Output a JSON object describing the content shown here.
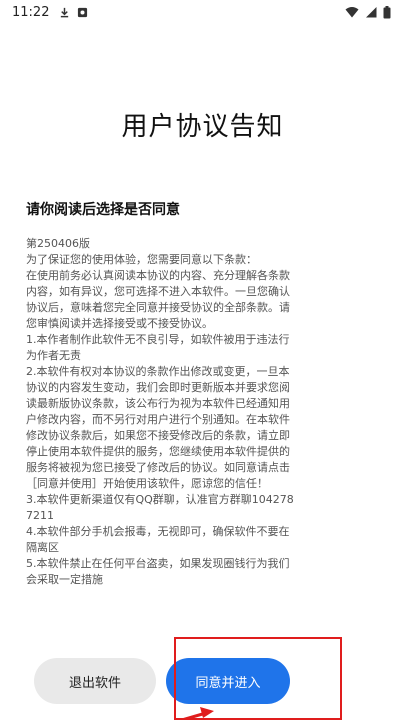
{
  "status_bar": {
    "time": "11:22",
    "notification_icons": [
      "download-icon",
      "app-notification-icon"
    ],
    "system_icons": [
      "wifi-icon",
      "cellular-signal-icon",
      "battery-icon"
    ]
  },
  "title": "用户协议告知",
  "subtitle": "请你阅读后选择是否同意",
  "agreement": {
    "text": "第250406版\n为了保证您的使用体验，您需要同意以下条款：\n在使用前务必认真阅读本协议的内容、充分理解各条款内容，如有异议，您可选择不进入本软件。一旦您确认协议后，意味着您完全同意并接受协议的全部条款。请您审慎阅读并选择接受或不接受协议。\n1.本作者制作此软件无不良引导，如软件被用于违法行为作者无责\n2.本软件有权对本协议的条款作出修改或变更，一旦本协议的内容发生变动，我们会即时更新版本并要求您阅读最新版协议条款，该公布行为视为本软件已经通知用户修改内容，而不另行对用户进行个别通知。在本软件修改协议条款后，如果您不接受修改后的条款，请立即停止使用本软件提供的服务，您继续使用本软件提供的服务将被视为您已接受了修改后的协议。如同意请点击［同意并使用］开始使用该软件，愿谅您的信任！\n3.本软件更新渠道仅有QQ群聊，认准官方群聊1042787211\n4.本软件部分手机会报毒，无视即可，确保软件不要在隔离区\n5.本软件禁止在任何平台盗卖，如果发现圈钱行为我们会采取一定措施"
  },
  "buttons": {
    "exit_label": "退出软件",
    "enter_label": "同意并进入"
  },
  "colors": {
    "primary": "#1f74ea",
    "secondary_button": "#e9e9e9",
    "annotation": "#e01d1d"
  }
}
